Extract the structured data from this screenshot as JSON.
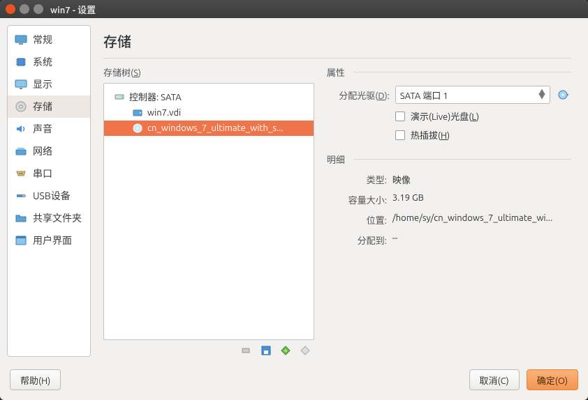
{
  "window": {
    "title": "win7 - 设置"
  },
  "sidebar": {
    "items": [
      {
        "label": "常规",
        "icon": "monitor"
      },
      {
        "label": "系统",
        "icon": "chip"
      },
      {
        "label": "显示",
        "icon": "display"
      },
      {
        "label": "存储",
        "icon": "disk",
        "selected": true
      },
      {
        "label": "声音",
        "icon": "sound"
      },
      {
        "label": "网络",
        "icon": "network"
      },
      {
        "label": "串口",
        "icon": "serial"
      },
      {
        "label": "USB设备",
        "icon": "usb"
      },
      {
        "label": "共享文件夹",
        "icon": "folder"
      },
      {
        "label": "用户界面",
        "icon": "ui"
      }
    ]
  },
  "page": {
    "title": "存储",
    "storage_tree_label": "存储树(S)",
    "controller": {
      "label": "控制器: SATA"
    },
    "tree_items": [
      {
        "label": "win7.vdi",
        "icon": "hdd"
      },
      {
        "label": "cn_windows_7_ultimate_with_s...",
        "icon": "disc",
        "selected": true
      }
    ],
    "attributes": {
      "section_label": "属性",
      "drive_label": "分配光驱(D):",
      "drive_value": "SATA 端口 1",
      "live_cd_label": "演示(Live)光盘(L)",
      "hotplug_label": "热插拔(H)"
    },
    "details": {
      "section_label": "明细",
      "rows": [
        {
          "label": "类型:",
          "value": "映像"
        },
        {
          "label": "容量大小:",
          "value": "3.19 GB"
        },
        {
          "label": "位置:",
          "value": "/home/sy/cn_windows_7_ultimate_wi..."
        },
        {
          "label": "分配到:",
          "value": "--"
        }
      ]
    }
  },
  "footer": {
    "help": "帮助(H)",
    "cancel": "取消(C)",
    "ok": "确定(O)"
  }
}
